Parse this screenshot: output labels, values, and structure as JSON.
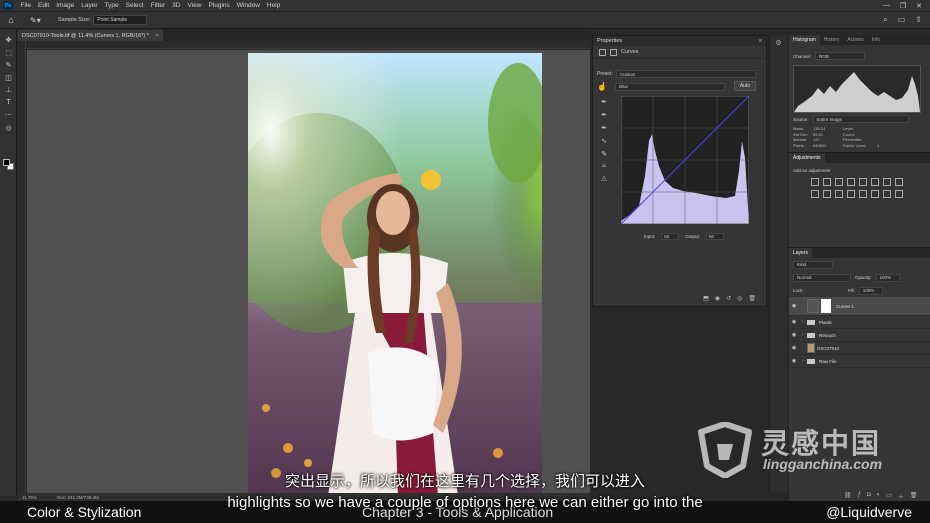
{
  "menubar": {
    "logo": "Ps",
    "items": [
      "File",
      "Edit",
      "Image",
      "Layer",
      "Type",
      "Select",
      "Filter",
      "3D",
      "View",
      "Plugins",
      "Window",
      "Help"
    ],
    "controls": [
      "—",
      "❐",
      "✕"
    ]
  },
  "options_bar": {
    "sample_size_label": "Sample Size:",
    "sample_size_value": "Point Sample"
  },
  "document": {
    "tab_title": "DSC07910-Tools.tif @ 11.4% (Curves 1, RGB/16*) *",
    "zoom_status": "11.79%",
    "doc_status": "Doc: 241.3M/738.4M"
  },
  "properties": {
    "panel_title": "Properties",
    "adjustment_name": "Curves",
    "preset_label": "Preset:",
    "preset_value": "Custom",
    "channel_value": "Blue",
    "auto_label": "Auto",
    "input_label": "Input:",
    "input_value": "60",
    "output_label": "Output:",
    "output_value": "60"
  },
  "histogram_panel": {
    "tabs": [
      "Histogram",
      "History",
      "Actions",
      "Info"
    ],
    "channel_label": "Channel:",
    "channel_value": "RGB",
    "source_label": "Source:",
    "source_value": "Entire Image",
    "stats": [
      {
        "label": "Mean:",
        "value": "138.14"
      },
      {
        "label": "Std Dev:",
        "value": "55.51"
      },
      {
        "label": "Median:",
        "value": "137"
      },
      {
        "label": "Pixels:",
        "value": "649822"
      }
    ],
    "stats_right": [
      {
        "label": "Level:",
        "value": ""
      },
      {
        "label": "Count:",
        "value": ""
      },
      {
        "label": "Percentile:",
        "value": ""
      },
      {
        "label": "Cache Level:",
        "value": "4"
      }
    ]
  },
  "adjustments": {
    "title": "Adjustments",
    "add_label": "Add an adjustment"
  },
  "layers": {
    "title": "Layers",
    "filter_value": "Kind",
    "blend_value": "Normal",
    "opacity_label": "Opacity:",
    "opacity_value": "100%",
    "lock_label": "Lock:",
    "fill_label": "Fill:",
    "fill_value": "100%",
    "items": [
      {
        "name": "Curves 1",
        "type": "adjustment"
      },
      {
        "name": "Plastic",
        "type": "group"
      },
      {
        "name": "Retouch",
        "type": "group"
      },
      {
        "name": "DSC07910",
        "type": "image"
      },
      {
        "name": "Raw File",
        "type": "group"
      }
    ]
  },
  "overlay": {
    "subtitle_cn": "突出显示，所以我们在这里有几个选择，我们可以进入",
    "subtitle_en": "highlights so we have a couple of options here we can either go into the",
    "course_left": "Color & Stylization",
    "course_mid": "Chapter 3 - Tools & Application",
    "course_right": "@Liquidverve",
    "watermark_title": "灵感中国",
    "watermark_url": "lingganchina.com"
  },
  "colors": {
    "accent": "#31a8ff",
    "panel_bg": "#353535",
    "curve_fill": "#c9c3f0",
    "curve_line": "#4a4af0"
  }
}
